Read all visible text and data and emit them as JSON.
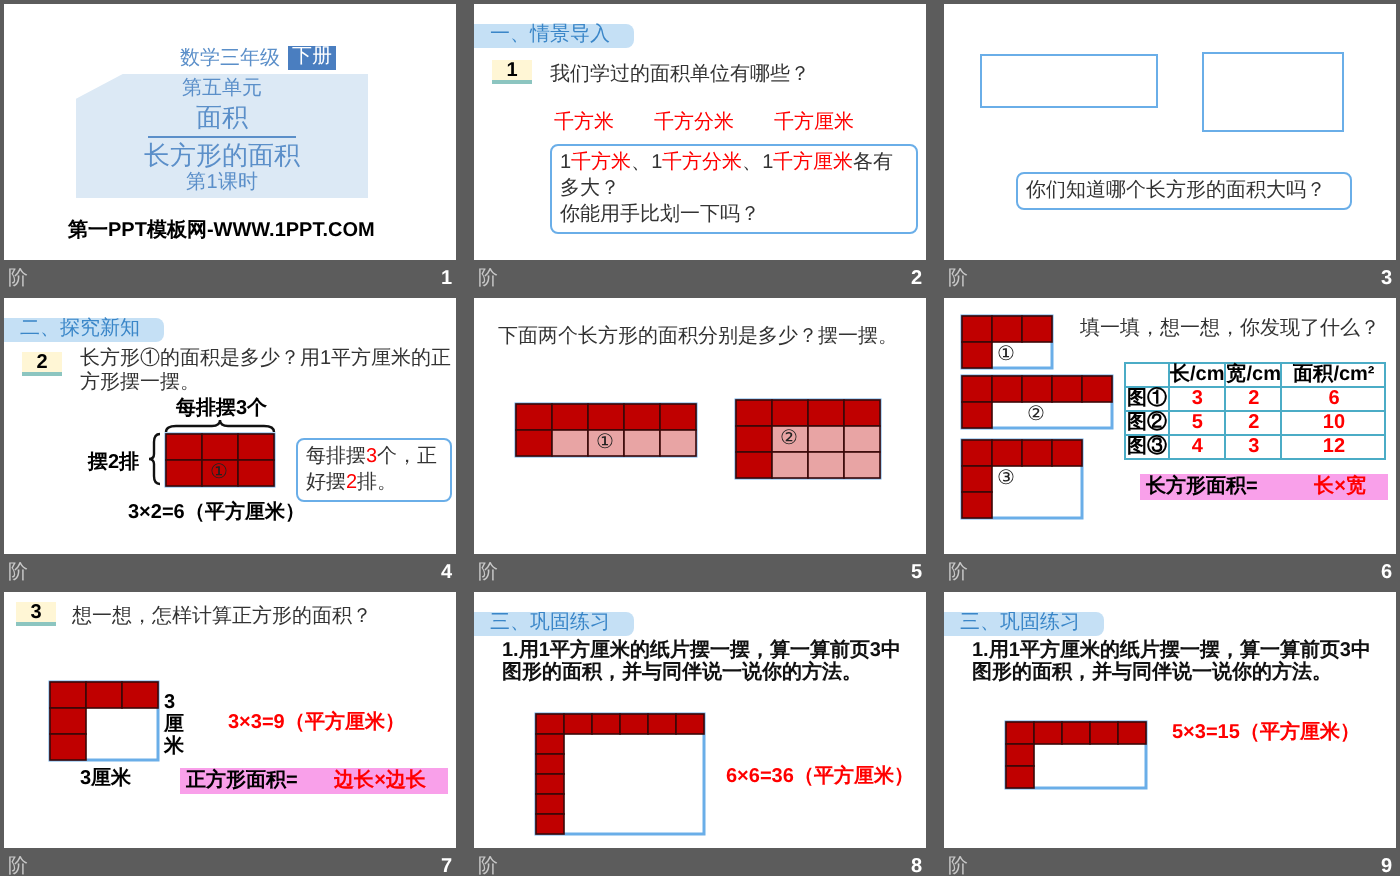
{
  "slides": [
    {
      "kind": "title",
      "number": "1",
      "footer_mark": "阶",
      "subject": "数学三年级",
      "volume": "下册",
      "unit": "第五单元",
      "topic": "面积",
      "lesson": "长方形的面积",
      "period": "第1课时",
      "site": "第一PPT模板网-WWW.1PPT.COM"
    },
    {
      "kind": "intro",
      "number": "2",
      "footer_mark": "阶",
      "section": "一、情景导入",
      "badge": "1",
      "question": "我们学过的面积单位有哪些？",
      "units": [
        "千方米",
        "千方分米",
        "千方厘米"
      ],
      "bubble": [
        [
          {
            "text": "1",
            "emphasis": false
          },
          {
            "text": "千方米",
            "emphasis": true
          },
          {
            "text": "、1",
            "emphasis": false
          },
          {
            "text": "千方分米",
            "emphasis": true
          },
          {
            "text": "、1",
            "emphasis": false
          },
          {
            "text": "千方厘米",
            "emphasis": true
          },
          {
            "text": "各有多大？",
            "emphasis": false
          }
        ],
        [
          {
            "text": "你能用手比划一下吗？",
            "emphasis": false
          }
        ]
      ]
    },
    {
      "kind": "compare",
      "number": "3",
      "footer_mark": "阶",
      "bubble": [
        [
          {
            "text": "你们知道哪个长方形的面积大吗？",
            "emphasis": false
          }
        ]
      ]
    },
    {
      "kind": "explore",
      "number": "4",
      "footer_mark": "阶",
      "section": "二、探究新知",
      "badge": "2",
      "question": "长方形①的面积是多少？用1平方厘米的正方形摆一摆。",
      "top_label": "每排摆3个",
      "side_label": "摆2排",
      "shapes": [
        {
          "label": "①"
        }
      ],
      "formula": "3×2=6（平方厘米）",
      "bubble": [
        [
          {
            "text": "每排摆",
            "emphasis": false
          },
          {
            "text": "3",
            "emphasis": true
          },
          {
            "text": "个，正好摆",
            "emphasis": false
          },
          {
            "text": "2",
            "emphasis": true
          },
          {
            "text": "排。",
            "emphasis": false
          }
        ]
      ]
    },
    {
      "kind": "arrange",
      "number": "5",
      "footer_mark": "阶",
      "question": "下面两个长方形的面积分别是多少？摆一摆。",
      "shapes": [
        {
          "label": "①"
        },
        {
          "label": "②"
        }
      ]
    },
    {
      "kind": "table",
      "number": "6",
      "footer_mark": "阶",
      "question": "填一填，想一想，你发现了什么？",
      "shapes": [
        {
          "label": "①"
        },
        {
          "label": "②"
        },
        {
          "label": "③"
        }
      ],
      "table": {
        "columns": [
          "",
          "长/cm",
          "宽/cm",
          "面积/cm²"
        ],
        "rows": [
          [
            "图①",
            "3",
            "2",
            "6"
          ],
          [
            "图②",
            "5",
            "2",
            "10"
          ],
          [
            "图③",
            "4",
            "3",
            "12"
          ]
        ]
      },
      "rule": {
        "left": "长方形面积=",
        "right": "长×宽"
      }
    },
    {
      "kind": "square",
      "number": "7",
      "footer_mark": "阶",
      "badge": "3",
      "question": "想一想，怎样计算正方形的面积？",
      "side_label": "3厘米",
      "bottom_label": "3厘米",
      "formula": "3×3=9（平方厘米）",
      "rule": {
        "left": "正方形面积=",
        "right": "边长×边长"
      }
    },
    {
      "kind": "practice",
      "number": "8",
      "footer_mark": "阶",
      "section": "三、巩固练习",
      "task": "1.用1平方厘米的纸片摆一摆，算一算前页3中图形的面积，并与同伴说一说你的方法。",
      "formula": "6×6=36（平方厘米）"
    },
    {
      "kind": "practice",
      "number": "9",
      "footer_mark": "阶",
      "section": "三、巩固练习",
      "task": "1.用1平方厘米的纸片摆一摆，算一算前页3中图形的面积，并与同伴说一说你的方法。",
      "formula": "5×3=15（平方厘米）"
    }
  ]
}
